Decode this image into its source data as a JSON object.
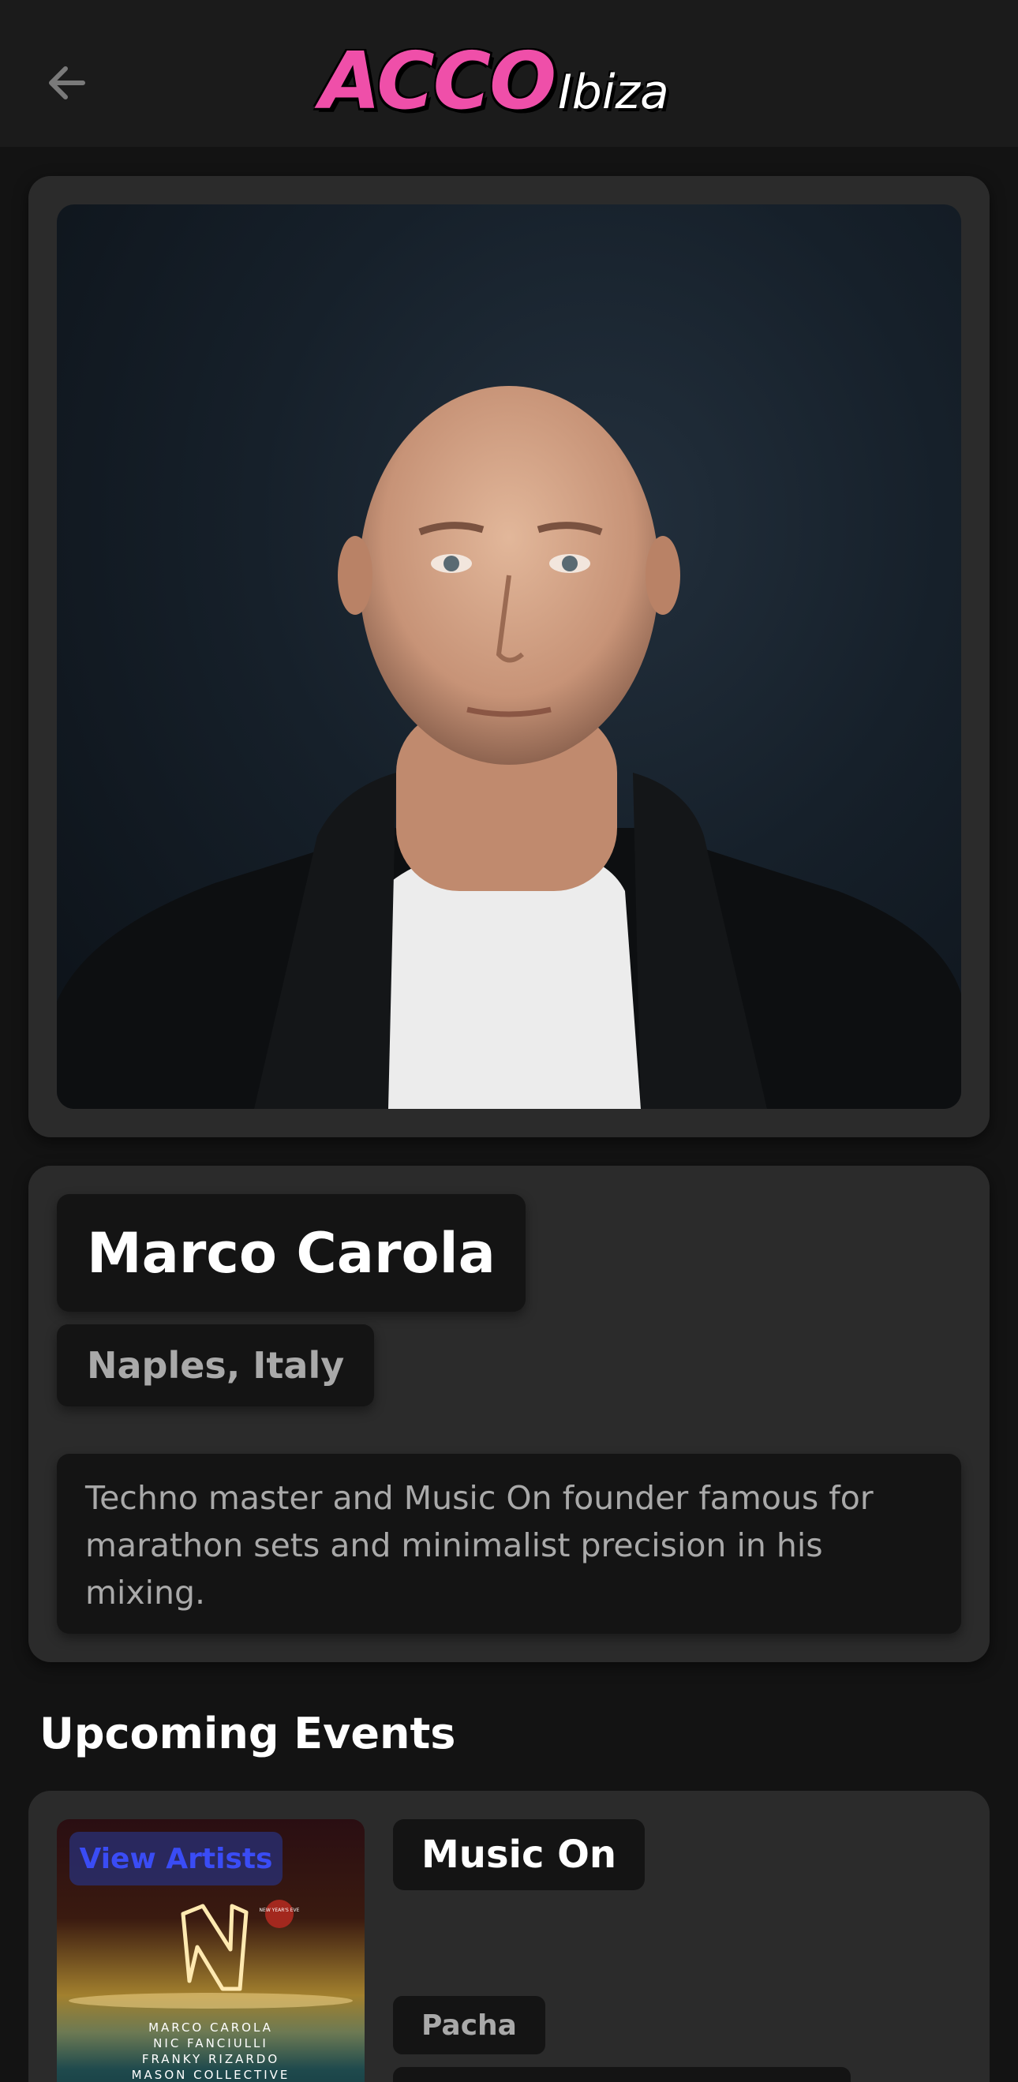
{
  "header": {
    "back_icon": "arrow-left-icon",
    "logo_main": "ACCO",
    "logo_sub": "Ibiza",
    "logo_color": "#ef4fa9"
  },
  "artist": {
    "photo_alt": "Portrait of Marco Carola",
    "name": "Marco Carola",
    "location": "Naples, Italy",
    "bio": "Techno master and Music On founder famous for marathon sets and minimalist precision in his mixing."
  },
  "upcoming": {
    "title": "Upcoming Events",
    "events": [
      {
        "view_artists_label": "View Artists",
        "poster_lines": [
          "MARCO CAROLA",
          "NIC FANCIULLI",
          "FRANKY RIZARDO",
          "MASON COLLECTIVE"
        ],
        "poster_badge": "NEW YEAR'S EVE",
        "name": "Music On",
        "venue": "Pacha"
      }
    ]
  }
}
